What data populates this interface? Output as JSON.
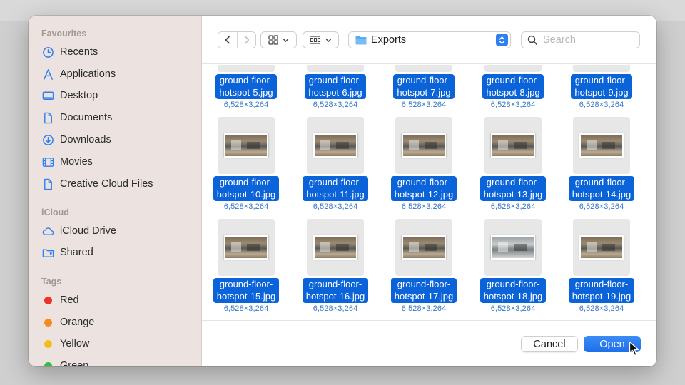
{
  "sidebar": {
    "favourites_title": "Favourites",
    "favourites": [
      {
        "label": "Recents",
        "icon": "clock-icon"
      },
      {
        "label": "Applications",
        "icon": "applications-icon"
      },
      {
        "label": "Desktop",
        "icon": "desktop-icon"
      },
      {
        "label": "Documents",
        "icon": "document-icon"
      },
      {
        "label": "Downloads",
        "icon": "download-icon"
      },
      {
        "label": "Movies",
        "icon": "film-icon"
      },
      {
        "label": "Creative Cloud Files",
        "icon": "file-icon"
      }
    ],
    "icloud_title": "iCloud",
    "icloud": [
      {
        "label": "iCloud Drive",
        "icon": "cloud-icon"
      },
      {
        "label": "Shared",
        "icon": "shared-folder-icon"
      }
    ],
    "tags_title": "Tags",
    "tags": [
      {
        "label": "Red",
        "color": "#f0302a"
      },
      {
        "label": "Orange",
        "color": "#f58b1f"
      },
      {
        "label": "Yellow",
        "color": "#f3be1b"
      },
      {
        "label": "Green",
        "color": "#2fbf34"
      }
    ]
  },
  "toolbar": {
    "location": "Exports",
    "search_placeholder": "Search"
  },
  "files": [
    {
      "name1": "ground-floor-",
      "name2": "hotspot-5.jpg",
      "size": "6,528×3,264"
    },
    {
      "name1": "ground-floor-",
      "name2": "hotspot-6.jpg",
      "size": "6,528×3,264"
    },
    {
      "name1": "ground-floor-",
      "name2": "hotspot-7.jpg",
      "size": "6,528×3,264"
    },
    {
      "name1": "ground-floor-",
      "name2": "hotspot-8.jpg",
      "size": "6,528×3,264"
    },
    {
      "name1": "ground-floor-",
      "name2": "hotspot-9.jpg",
      "size": "6,528×3,264"
    },
    {
      "name1": "ground-floor-",
      "name2": "hotspot-10.jpg",
      "size": "6,528×3,264"
    },
    {
      "name1": "ground-floor-",
      "name2": "hotspot-11.jpg",
      "size": "6,528×3,264"
    },
    {
      "name1": "ground-floor-",
      "name2": "hotspot-12.jpg",
      "size": "6,528×3,264"
    },
    {
      "name1": "ground-floor-",
      "name2": "hotspot-13.jpg",
      "size": "6,528×3,264"
    },
    {
      "name1": "ground-floor-",
      "name2": "hotspot-14.jpg",
      "size": "6,528×3,264"
    },
    {
      "name1": "ground-floor-",
      "name2": "hotspot-15.jpg",
      "size": "6,528×3,264"
    },
    {
      "name1": "ground-floor-",
      "name2": "hotspot-16.jpg",
      "size": "6,528×3,264"
    },
    {
      "name1": "ground-floor-",
      "name2": "hotspot-17.jpg",
      "size": "6,528×3,264"
    },
    {
      "name1": "ground-floor-",
      "name2": "hotspot-18.jpg",
      "size": "6,528×3,264"
    },
    {
      "name1": "ground-floor-",
      "name2": "hotspot-19.jpg",
      "size": "6,528×3,264"
    }
  ],
  "footer": {
    "cancel_label": "Cancel",
    "open_label": "Open"
  },
  "colors": {
    "accent": "#0a63d8",
    "sidebar_bg": "#ece3e1"
  }
}
